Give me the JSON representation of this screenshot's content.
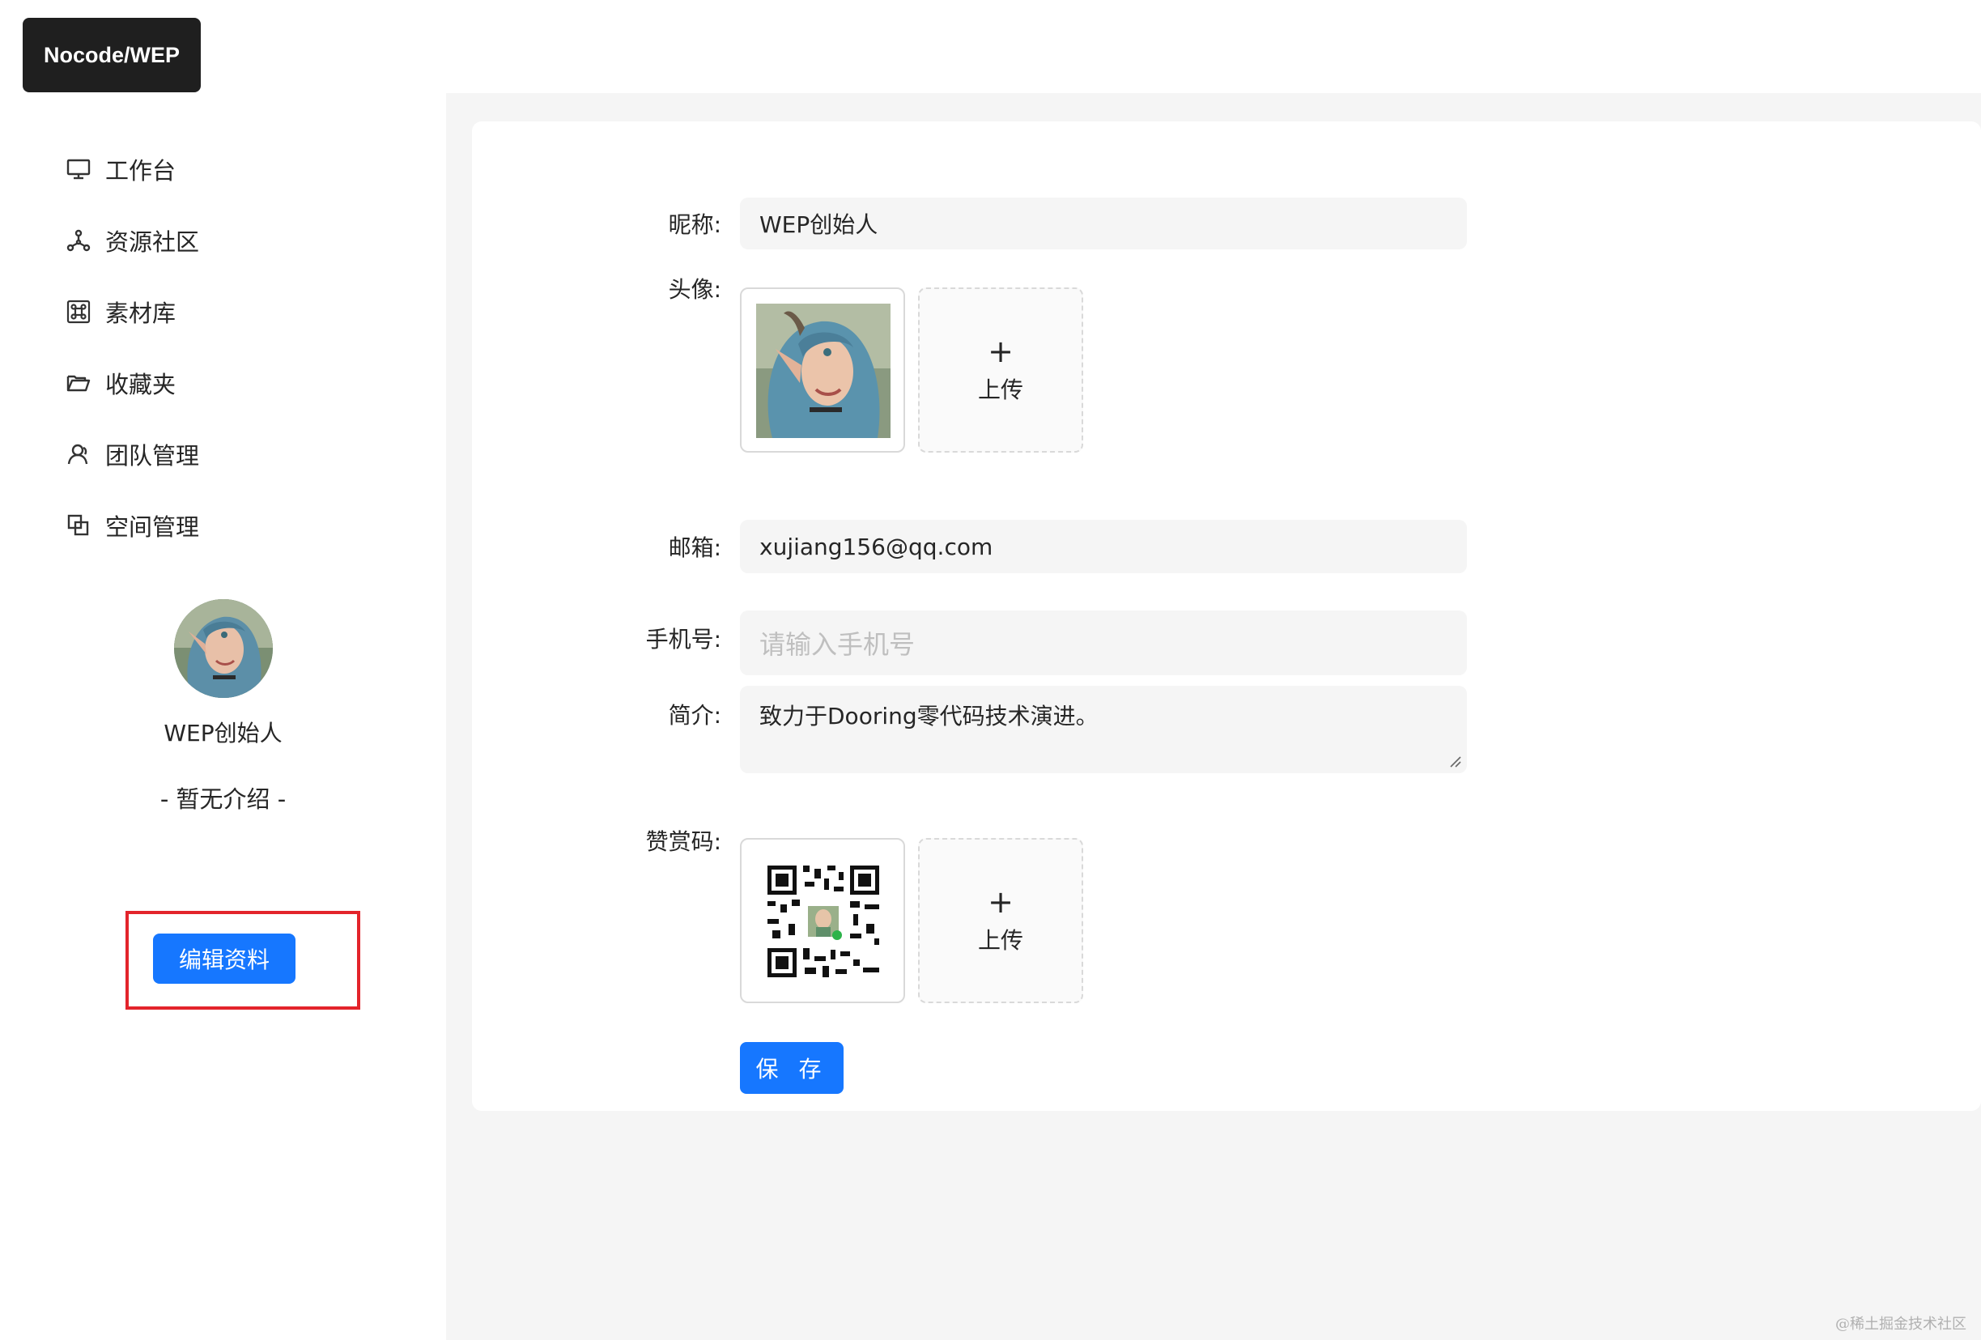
{
  "app": {
    "logo_text": "Nocode/WEP"
  },
  "sidebar": {
    "items": [
      {
        "label": "工作台",
        "icon": "desktop-icon"
      },
      {
        "label": "资源社区",
        "icon": "network-icon"
      },
      {
        "label": "素材库",
        "icon": "command-icon"
      },
      {
        "label": "收藏夹",
        "icon": "folder-open-icon"
      },
      {
        "label": "团队管理",
        "icon": "team-icon"
      },
      {
        "label": "空间管理",
        "icon": "block-icon"
      }
    ],
    "profile": {
      "name": "WEP创始人",
      "intro": "- 暂无介绍 -",
      "edit_label": "编辑资料"
    }
  },
  "form": {
    "nickname": {
      "label": "昵称:",
      "value": "WEP创始人"
    },
    "avatar": {
      "label": "头像:",
      "upload_label": "上传"
    },
    "email": {
      "label": "邮箱:",
      "value": "xujiang156@qq.com"
    },
    "phone": {
      "label": "手机号:",
      "placeholder": "请输入手机号"
    },
    "bio": {
      "label": "简介:",
      "value": "致力于Dooring零代码技术演进。"
    },
    "reward_code": {
      "label": "赞赏码:",
      "upload_label": "上传"
    },
    "save_label": "保 存"
  },
  "watermark": "@稀土掘金技术社区",
  "colors": {
    "primary": "#1677ff",
    "highlight_border": "#e3242b",
    "logo_bg": "#1f1f1f"
  }
}
